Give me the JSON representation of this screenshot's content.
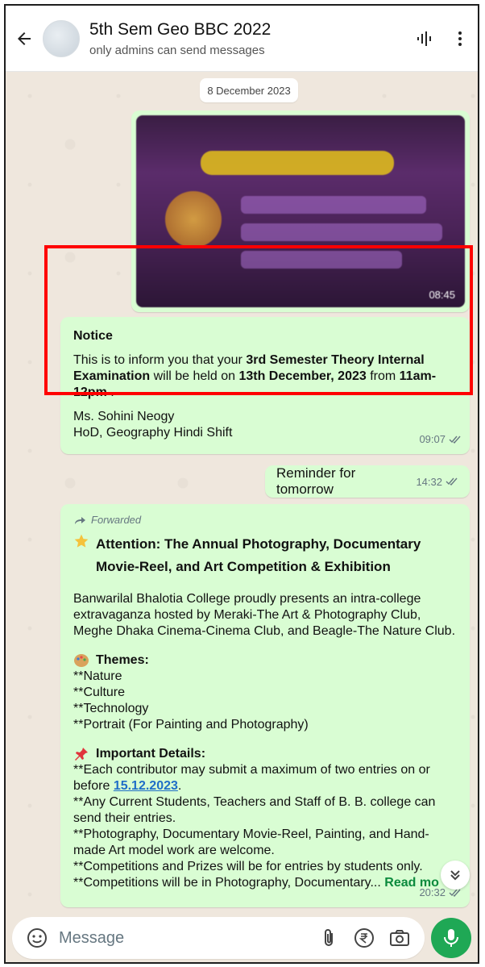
{
  "header": {
    "title": "5th Sem Geo BBC 2022",
    "subtitle": "only admins can send messages",
    "back_icon": "back-arrow-icon",
    "voice_icon": "voice-waveform-icon",
    "menu_icon": "more-vertical-icon"
  },
  "chat": {
    "date_chip": "8 December 2023",
    "image_message": {
      "time": "08:45"
    },
    "notice_message": {
      "title": "Notice",
      "line_a": "This is to inform you that your ",
      "bold_a": "3rd Semester Theory Internal Examination",
      "line_b": " will be held on ",
      "bold_b": "13th December, 2023",
      "line_c": " from ",
      "bold_c": "11am-12pm",
      "line_d": " .",
      "sign_name": "Ms. Sohini Neogy",
      "sign_role": "HoD, Geography Hindi Shift",
      "time": "09:07"
    },
    "reminder_message": {
      "text": "Reminder for tomorrow",
      "time": "14:32"
    },
    "forwarded_message": {
      "forwarded_label": "Forwarded",
      "heading_line1": "Attention: The Annual Photography, Documentary",
      "heading_line2": "Movie-Reel, and Art Competition & Exhibition",
      "intro": "Banwarilal Bhalotia College proudly presents an intra-college extravaganza hosted by Meraki-The Art & Photography Club, Meghe Dhaka Cinema-Cinema Club, and Beagle-The Nature Club.",
      "themes_title": "Themes:",
      "themes": [
        "**Nature",
        "**Culture",
        "**Technology",
        "**Portrait (For Painting and Photography)"
      ],
      "details_title": "Important Details:",
      "detail1_prefix": "**Each contributor may submit a maximum of two entries on or before ",
      "detail1_link": "15.12.2023",
      "detail1_suffix": ".",
      "detail2": "**Any Current Students, Teachers and Staff of B. B. college can send their entries.",
      "detail3": "**Photography,  Documentary Movie-Reel, Painting, and Hand-made Art model work are welcome.",
      "detail4": "**Competitions and Prizes will be for entries by students only.",
      "detail5": "**Competitions will be in Photography, Documentary...",
      "read_more": "Read mo",
      "time": "20:32"
    }
  },
  "composer": {
    "placeholder": "Message",
    "emoji_icon": "emoji-sticker-icon",
    "attach_icon": "paperclip-icon",
    "payment_icon": "rupee-icon",
    "camera_icon": "camera-icon",
    "mic_icon": "mic-icon"
  },
  "colors": {
    "bubble_out": "#d9fdd3",
    "chat_bg": "#efe7dd",
    "accent_green": "#1fa855",
    "highlight": "#ff0000",
    "tick_gray": "#667781"
  }
}
